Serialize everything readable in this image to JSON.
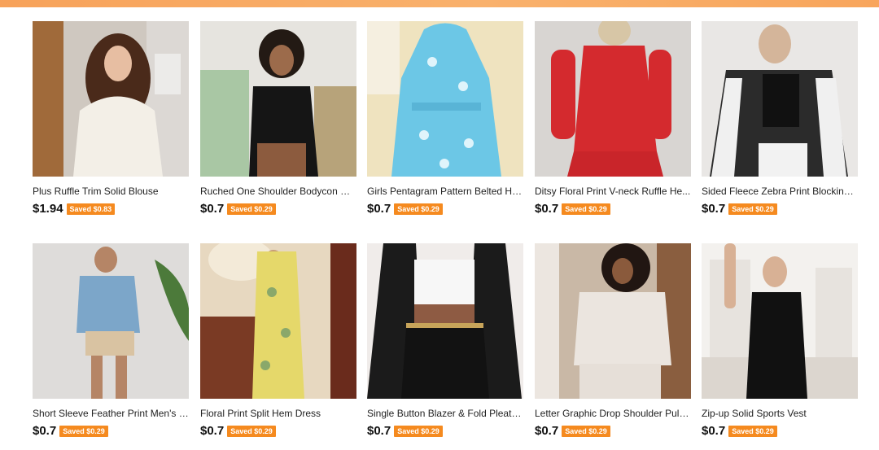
{
  "theme": {
    "accent": "#f58a1f",
    "top_bar": "#f8a55c"
  },
  "products": [
    {
      "title": "Plus Ruffle Trim Solid Blouse",
      "price": "$1.94",
      "saved": "Saved $0.83",
      "image": "woman-white-blouse-photo"
    },
    {
      "title": "Ruched One Shoulder Bodycon Dr...",
      "price": "$0.7",
      "saved": "Saved $0.29",
      "image": "woman-black-dress-photo"
    },
    {
      "title": "Girls Pentagram Pattern Belted Ho...",
      "price": "$0.7",
      "saved": "Saved $0.29",
      "image": "blue-star-robe-photo"
    },
    {
      "title": "Ditsy Floral Print V-neck Ruffle He...",
      "price": "$0.7",
      "saved": "Saved $0.29",
      "image": "woman-red-floral-dress-photo"
    },
    {
      "title": "Sided Fleece Zebra Print Blocking ...",
      "price": "$0.7",
      "saved": "Saved $0.29",
      "image": "woman-zebra-jacket-photo"
    },
    {
      "title": "Short Sleeve Feather Print Men's C...",
      "price": "$0.7",
      "saved": "Saved $0.29",
      "image": "man-print-shirt-photo"
    },
    {
      "title": "Floral Print Split Hem Dress",
      "price": "$0.7",
      "saved": "Saved $0.29",
      "image": "woman-yellow-floral-dress-photo"
    },
    {
      "title": "Single Button Blazer & Fold Pleate...",
      "price": "$0.7",
      "saved": "Saved $0.29",
      "image": "woman-black-blazer-skirt-photo"
    },
    {
      "title": "Letter Graphic Drop Shoulder Pullo...",
      "price": "$0.7",
      "saved": "Saved $0.29",
      "image": "woman-grey-pullover-photo"
    },
    {
      "title": "Zip-up Solid Sports Vest",
      "price": "$0.7",
      "saved": "Saved $0.29",
      "image": "woman-black-vest-photo"
    }
  ]
}
